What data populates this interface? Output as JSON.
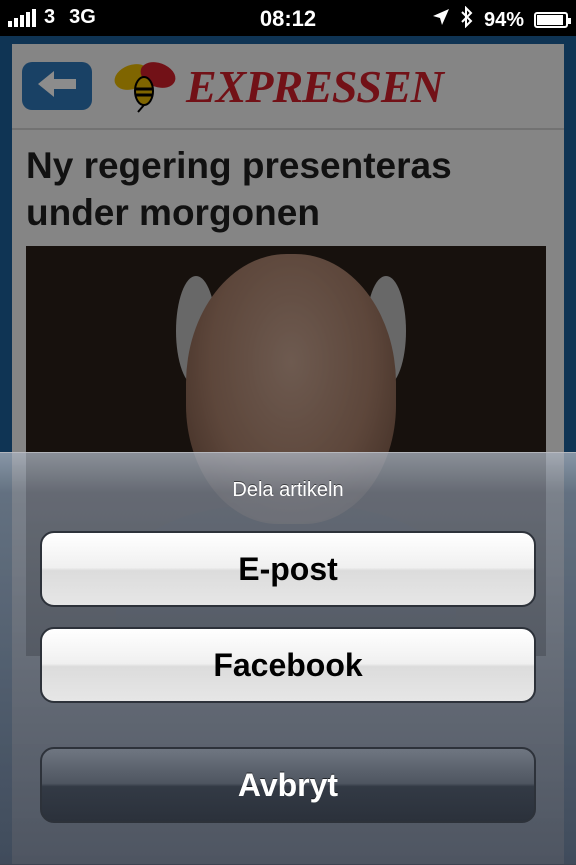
{
  "status_bar": {
    "carrier": "3",
    "network": "3G",
    "time": "08:12",
    "battery": "94%",
    "battery_level": 0.94
  },
  "page": {
    "logo": "EXPRESSEN",
    "headline": "Ny regering presenteras under morgonen"
  },
  "action_sheet": {
    "title": "Dela artikeln",
    "email_label": "E-post",
    "facebook_label": "Facebook",
    "cancel_label": "Avbryt"
  },
  "colors": {
    "brand_red": "#d0202b",
    "brand_blue": "#2f77b8"
  }
}
